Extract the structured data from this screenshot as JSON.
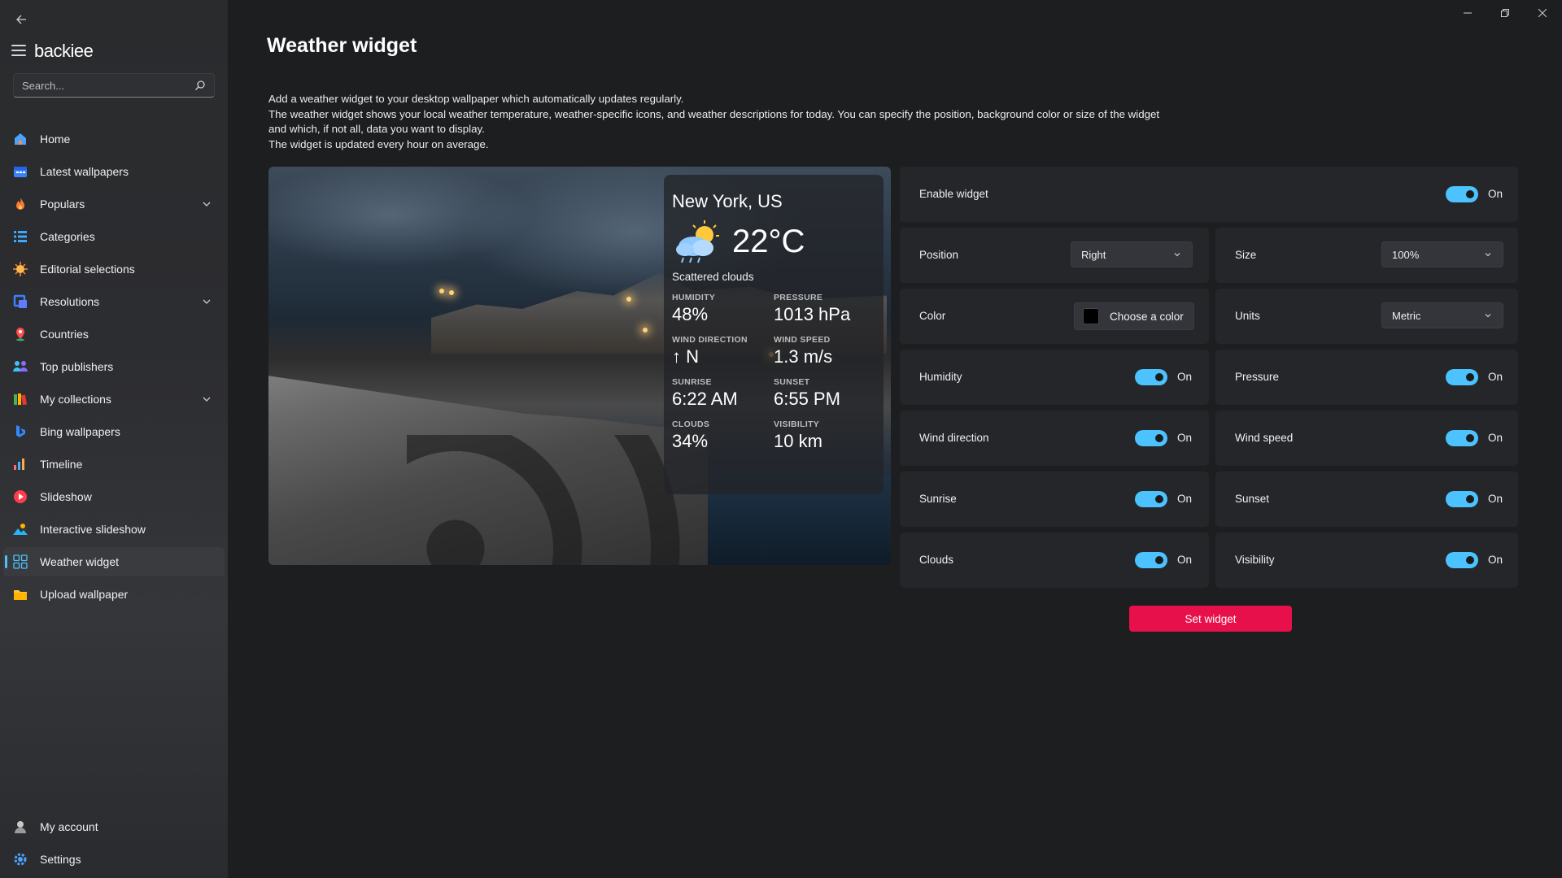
{
  "app": {
    "name": "backiee",
    "search_placeholder": "Search..."
  },
  "sidebar": {
    "items": [
      {
        "label": "Home",
        "icon": "home-icon"
      },
      {
        "label": "Latest wallpapers",
        "icon": "calendar-icon"
      },
      {
        "label": "Populars",
        "icon": "flame-icon",
        "expandable": true
      },
      {
        "label": "Categories",
        "icon": "list-icon"
      },
      {
        "label": "Editorial selections",
        "icon": "sparkle-icon"
      },
      {
        "label": "Resolutions",
        "icon": "crop-icon",
        "expandable": true
      },
      {
        "label": "Countries",
        "icon": "map-pin-icon"
      },
      {
        "label": "Top publishers",
        "icon": "people-icon"
      },
      {
        "label": "My collections",
        "icon": "books-icon",
        "expandable": true
      },
      {
        "label": "Bing wallpapers",
        "icon": "bing-icon"
      },
      {
        "label": "Timeline",
        "icon": "bar-chart-icon"
      },
      {
        "label": "Slideshow",
        "icon": "play-icon"
      },
      {
        "label": "Interactive slideshow",
        "icon": "landscape-icon"
      },
      {
        "label": "Weather widget",
        "icon": "widget-grid-icon",
        "active": true
      },
      {
        "label": "Upload wallpaper",
        "icon": "folder-upload-icon"
      }
    ],
    "bottom": [
      {
        "label": "My account",
        "icon": "account-icon"
      },
      {
        "label": "Settings",
        "icon": "gear-icon"
      }
    ]
  },
  "page": {
    "title": "Weather widget",
    "description": [
      "Add a weather widget to your desktop wallpaper which automatically updates regularly.",
      "The weather widget shows your local weather temperature, weather-specific icons, and weather descriptions for today. You can specify the position, background color or size of the widget and which, if not all, data you want to display.",
      "The widget is updated every hour on average."
    ]
  },
  "preview": {
    "city": "New York, US",
    "temperature": "22°C",
    "condition": "Scattered clouds",
    "stats": [
      {
        "label": "HUMIDITY",
        "value": "48%"
      },
      {
        "label": "PRESSURE",
        "value": "1013 hPa"
      },
      {
        "label": "WIND DIRECTION",
        "value": "↑ N"
      },
      {
        "label": "WIND SPEED",
        "value": "1.3 m/s"
      },
      {
        "label": "SUNRISE",
        "value": "6:22 AM"
      },
      {
        "label": "SUNSET",
        "value": "6:55 PM"
      },
      {
        "label": "CLOUDS",
        "value": "34%"
      },
      {
        "label": "VISIBILITY",
        "value": "10 km"
      }
    ]
  },
  "settings": {
    "enable_widget": {
      "label": "Enable widget",
      "state": "On"
    },
    "position": {
      "label": "Position",
      "value": "Right"
    },
    "size": {
      "label": "Size",
      "value": "100%"
    },
    "color": {
      "label": "Color",
      "button": "Choose a color",
      "swatch": "#000000"
    },
    "units": {
      "label": "Units",
      "value": "Metric"
    },
    "humidity": {
      "label": "Humidity",
      "state": "On"
    },
    "pressure": {
      "label": "Pressure",
      "state": "On"
    },
    "wind_direction": {
      "label": "Wind direction",
      "state": "On"
    },
    "wind_speed": {
      "label": "Wind speed",
      "state": "On"
    },
    "sunrise": {
      "label": "Sunrise",
      "state": "On"
    },
    "sunset": {
      "label": "Sunset",
      "state": "On"
    },
    "clouds": {
      "label": "Clouds",
      "state": "On"
    },
    "visibility": {
      "label": "Visibility",
      "state": "On"
    },
    "set_button": "Set widget"
  },
  "colors": {
    "accent": "#4cc2ff",
    "primary_button": "#e8104a",
    "background": "#1d1e20"
  }
}
